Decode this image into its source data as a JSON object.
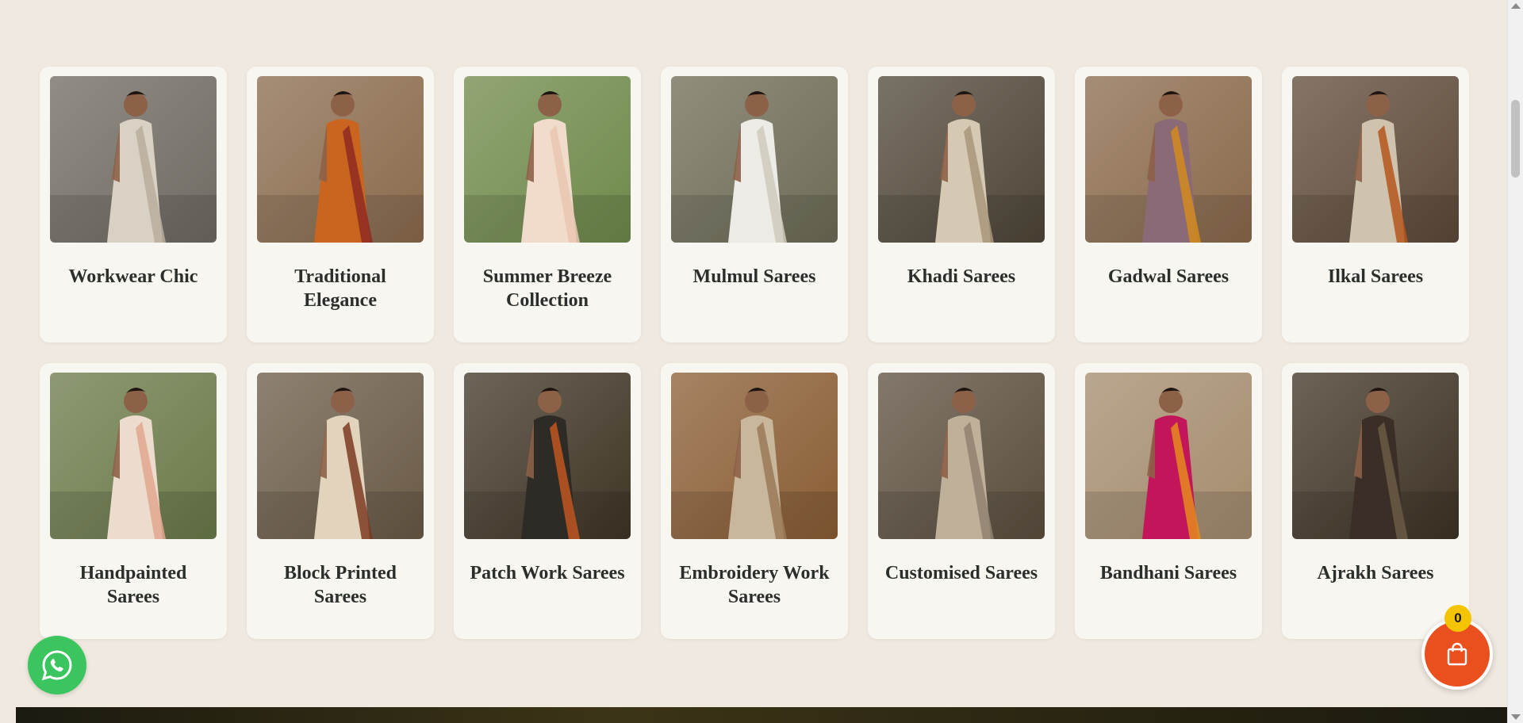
{
  "collections": [
    {
      "title": "Workwear Chic",
      "image_icon": "saree-photo-icon",
      "colors": {
        "bg": "#6f6a62",
        "saree": "#d9d1c4",
        "accent": "#b9ae9c"
      }
    },
    {
      "title": "Traditional Elegance",
      "image_icon": "saree-photo-icon",
      "colors": {
        "bg": "#8a6b4d",
        "saree": "#c9651f",
        "accent": "#8f2a22"
      }
    },
    {
      "title": "Summer Breeze Collection",
      "image_icon": "saree-photo-icon",
      "colors": {
        "bg": "#6f8a4b",
        "saree": "#f1dccb",
        "accent": "#e9c7b0"
      }
    },
    {
      "title": "Mulmul Sarees",
      "image_icon": "saree-photo-icon",
      "colors": {
        "bg": "#6e6b57",
        "saree": "#ecebe6",
        "accent": "#cfcabb"
      }
    },
    {
      "title": "Khadi Sarees",
      "image_icon": "saree-photo-icon",
      "colors": {
        "bg": "#4f4638",
        "saree": "#d6c9b3",
        "accent": "#a9967a"
      }
    },
    {
      "title": "Gadwal Sarees",
      "image_icon": "saree-photo-icon",
      "colors": {
        "bg": "#8a6a4c",
        "saree": "#8b6a78",
        "accent": "#d48a1c"
      }
    },
    {
      "title": "Ilkal Sarees",
      "image_icon": "saree-photo-icon",
      "colors": {
        "bg": "#5e4a3a",
        "saree": "#cfc3ae",
        "accent": "#b5561c"
      }
    },
    {
      "title": "Handpainted Sarees",
      "image_icon": "saree-photo-icon",
      "colors": {
        "bg": "#6b7a4a",
        "saree": "#ecdccd",
        "accent": "#e3a78e"
      }
    },
    {
      "title": "Block Printed Sarees",
      "image_icon": "saree-photo-icon",
      "colors": {
        "bg": "#6a5a47",
        "saree": "#e2d3bd",
        "accent": "#7b3a22"
      }
    },
    {
      "title": "Patch Work Sarees",
      "image_icon": "saree-photo-icon",
      "colors": {
        "bg": "#3f3526",
        "saree": "#2e2a26",
        "accent": "#c0561e"
      }
    },
    {
      "title": "Embroidery Work Sarees",
      "image_icon": "saree-photo-icon",
      "colors": {
        "bg": "#8a5d34",
        "saree": "#c9b79c",
        "accent": "#9a7a58"
      }
    },
    {
      "title": "Customised Sarees",
      "image_icon": "saree-photo-icon",
      "colors": {
        "bg": "#5b4e3e",
        "saree": "#bfb09a",
        "accent": "#8f8270"
      }
    },
    {
      "title": "Bandhani Sarees",
      "image_icon": "saree-photo-icon",
      "colors": {
        "bg": "#a58c6e",
        "saree": "#c2155a",
        "accent": "#e58a1e"
      }
    },
    {
      "title": "Ajrakh Sarees",
      "image_icon": "saree-photo-icon",
      "colors": {
        "bg": "#3e3325",
        "saree": "#3a2e26",
        "accent": "#6b5a45"
      }
    }
  ],
  "cart": {
    "count": "0",
    "icon": "shopping-bag-icon",
    "color": "#e9501d",
    "badge_color": "#f5c400"
  },
  "whatsapp": {
    "icon": "whatsapp-icon",
    "color": "#3ac55e"
  }
}
